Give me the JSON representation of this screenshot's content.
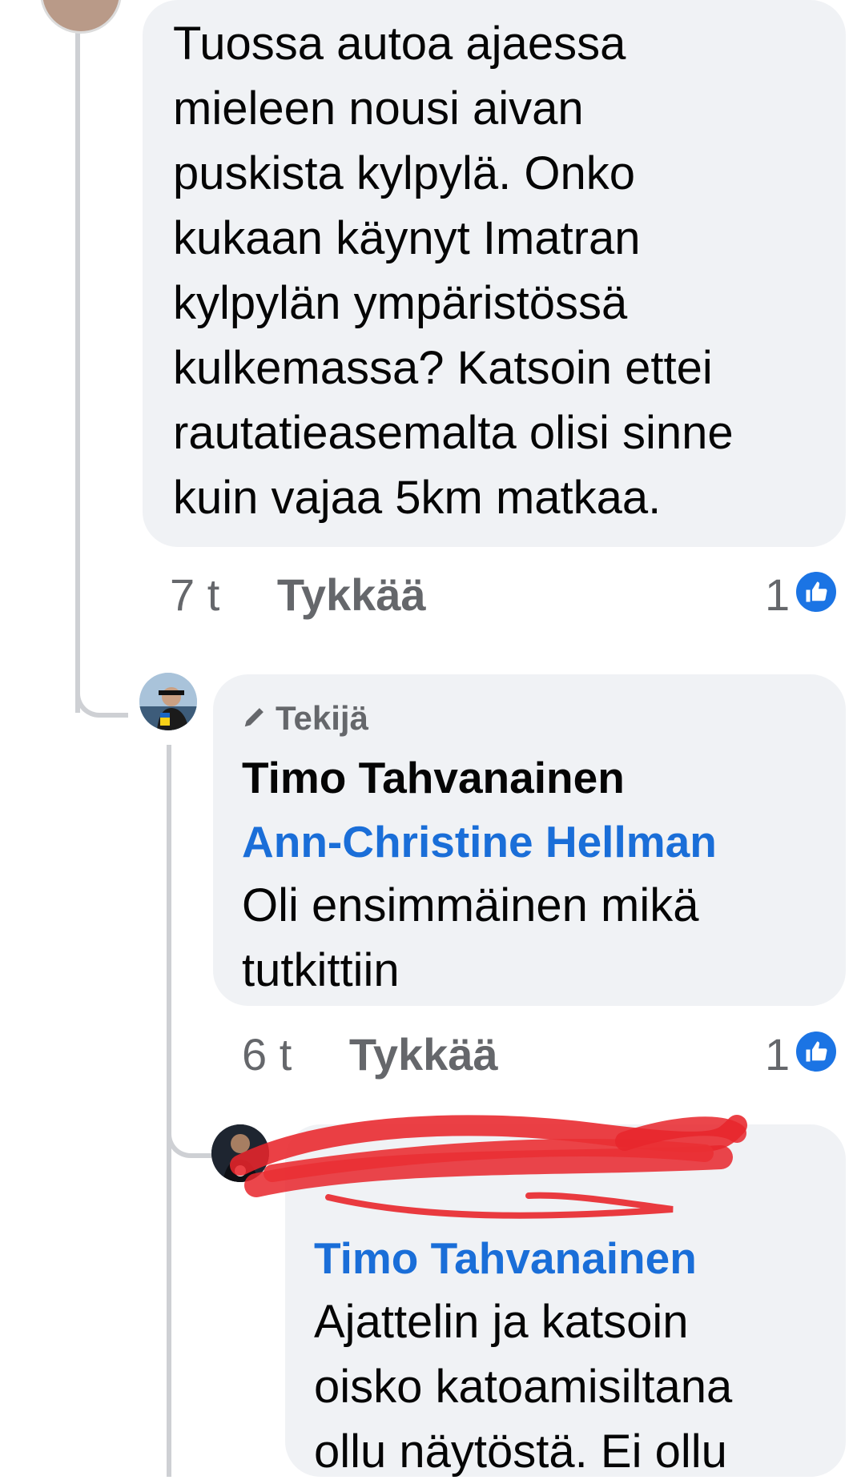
{
  "comment1": {
    "text_lines": [
      "Tuossa autoa ajaessa",
      "mieleen nousi aivan",
      "puskista kylpylä. Onko",
      "kukaan käynyt Imatran",
      "kylpylän ympäristössä",
      "kulkemassa? Katsoin ettei",
      "rautatieasemalta olisi sinne",
      "kuin vajaa 5km matkaa."
    ],
    "time": "7 t",
    "like_label": "Tykkää",
    "reaction_count": "1"
  },
  "reply1": {
    "badge": "Tekijä",
    "author": "Timo Tahvanainen",
    "mention": "Ann-Christine Hellman",
    "text_lines": [
      "Oli ensimmäinen mikä",
      "tutkittiin"
    ],
    "time": "6 t",
    "like_label": "Tykkää",
    "reaction_count": "1"
  },
  "reply2": {
    "mention": "Timo Tahvanainen",
    "text_lines": [
      "Ajattelin ja katsoin",
      "oisko katoamisiltana",
      "ollu näytöstä. Ei ollu"
    ]
  },
  "colors": {
    "bubble": "#f0f2f5",
    "mention": "#1a6ed8",
    "like_blue": "#1b74e4",
    "redaction": "#e8262b"
  }
}
